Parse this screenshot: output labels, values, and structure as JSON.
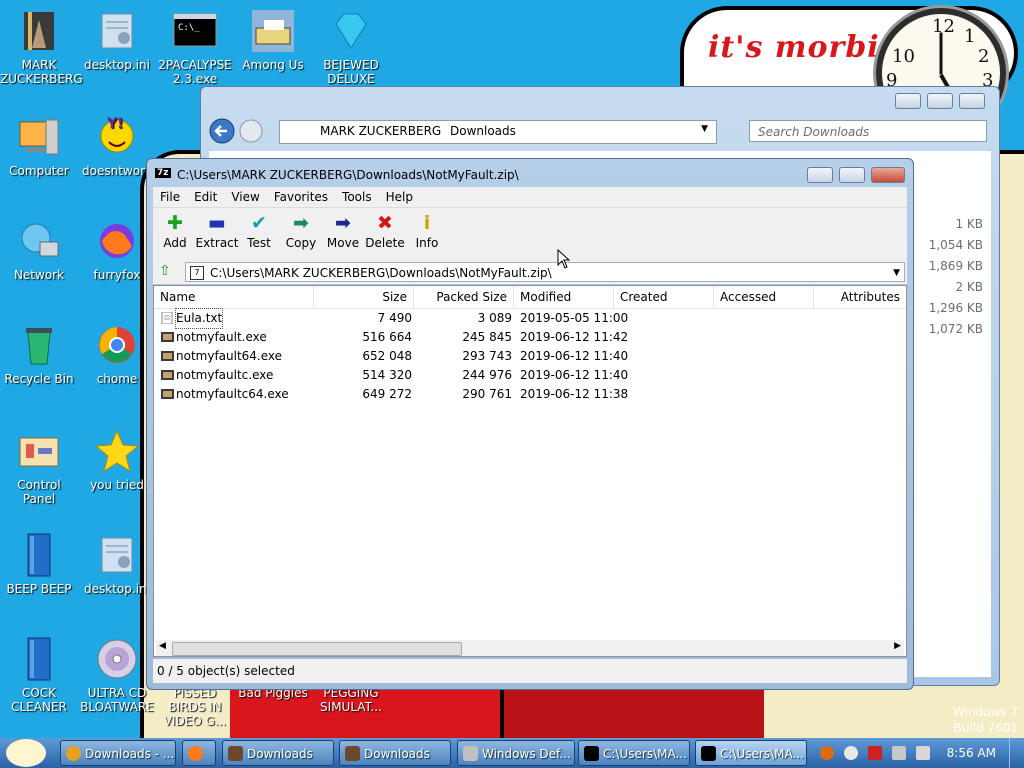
{
  "wallpaper": {
    "bubble_text": "it's morbin",
    "clock_numbers": [
      "12",
      "1",
      "2",
      "3",
      "10",
      "9"
    ],
    "os_line1": "Windows 7",
    "os_line2": "Build 7601"
  },
  "desktop_icons": [
    {
      "id": "mark",
      "label": "MARK ZUCKERBERG"
    },
    {
      "id": "desktopini1",
      "label": "desktop.ini"
    },
    {
      "id": "apocalypse",
      "label": "2PACALYPSE 2.3.exe"
    },
    {
      "id": "amongus",
      "label": "Among Us"
    },
    {
      "id": "bejeweled",
      "label": "BEJEWED DELUXE"
    },
    {
      "id": "computer",
      "label": "Computer"
    },
    {
      "id": "doesntwork",
      "label": "doesntwork"
    },
    {
      "id": "network",
      "label": "Network"
    },
    {
      "id": "furryfox",
      "label": "furryfox"
    },
    {
      "id": "recycle",
      "label": "Recycle Bin"
    },
    {
      "id": "chome",
      "label": "chome"
    },
    {
      "id": "controlpanel",
      "label": "Control Panel"
    },
    {
      "id": "youtried",
      "label": "you tried"
    },
    {
      "id": "beepbeep",
      "label": "BEEP BEEP"
    },
    {
      "id": "desktopini2",
      "label": "desktop.ini"
    },
    {
      "id": "cockcleaner",
      "label": "COCK CLEANER"
    },
    {
      "id": "ultracd",
      "label": "ULTRA CD BLOATWARE"
    },
    {
      "id": "pissedbirds",
      "label": "PISSED BIRDS IN VIDEO G..."
    },
    {
      "id": "badpiggies",
      "label": "Bad Piggies"
    },
    {
      "id": "pegging",
      "label": "PEGGING SIMULAT..."
    }
  ],
  "explorer": {
    "crumb1": "MARK ZUCKERBERG",
    "crumb2": "Downloads",
    "search_placeholder": "Search Downloads",
    "sizes": [
      "1 KB",
      "1,054 KB",
      "1,869 KB",
      "2 KB",
      "1,296 KB",
      "1,072 KB"
    ]
  },
  "zip": {
    "title": "C:\\Users\\MARK ZUCKERBERG\\Downloads\\NotMyFault.zip\\",
    "menu": [
      "File",
      "Edit",
      "View",
      "Favorites",
      "Tools",
      "Help"
    ],
    "toolbar": [
      "Add",
      "Extract",
      "Test",
      "Copy",
      "Move",
      "Delete",
      "Info"
    ],
    "path": "C:\\Users\\MARK ZUCKERBERG\\Downloads\\NotMyFault.zip\\",
    "columns": [
      "Name",
      "Size",
      "Packed Size",
      "Modified",
      "Created",
      "Accessed",
      "Attributes"
    ],
    "rows": [
      {
        "name": "Eula.txt",
        "size": "7 490",
        "packed": "3 089",
        "modified": "2019-05-05 11:00"
      },
      {
        "name": "notmyfault.exe",
        "size": "516 664",
        "packed": "245 845",
        "modified": "2019-06-12 11:42"
      },
      {
        "name": "notmyfault64.exe",
        "size": "652 048",
        "packed": "293 743",
        "modified": "2019-06-12 11:40"
      },
      {
        "name": "notmyfaultc.exe",
        "size": "514 320",
        "packed": "244 976",
        "modified": "2019-06-12 11:40"
      },
      {
        "name": "notmyfaultc64.exe",
        "size": "649 272",
        "packed": "290 761",
        "modified": "2019-06-12 11:38"
      }
    ],
    "status": "0 / 5 object(s) selected"
  },
  "taskbar": {
    "tasks": [
      "Downloads - ...",
      "Downloads",
      "Downloads",
      "Windows Def...",
      "C:\\Users\\MA...",
      "C:\\Users\\MA..."
    ],
    "time": "8:56 AM"
  }
}
